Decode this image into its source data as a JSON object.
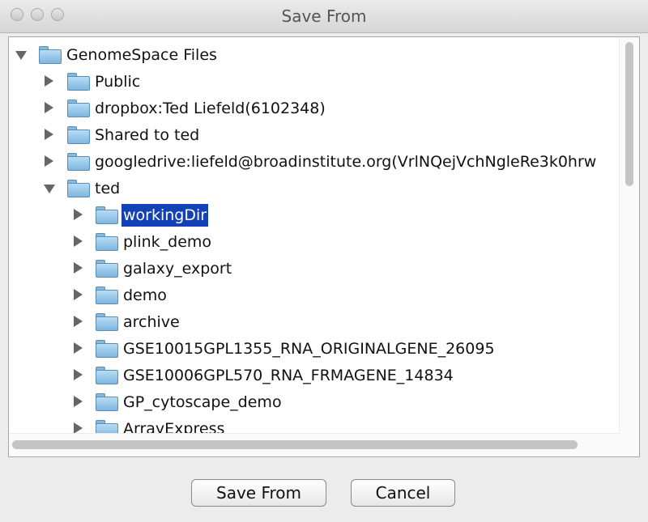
{
  "window": {
    "title": "Save From"
  },
  "tree": {
    "root": {
      "label": "GenomeSpace Files",
      "expanded": true
    },
    "top_items": [
      {
        "label": "Public",
        "expanded": false
      },
      {
        "label": "dropbox:Ted Liefeld(6102348)",
        "expanded": false
      },
      {
        "label": "Shared to ted",
        "expanded": false
      },
      {
        "label": "googledrive:liefeld@broadinstitute.org(VrlNQejVchNgleRe3k0hrw",
        "expanded": false
      },
      {
        "label": "ted",
        "expanded": true
      }
    ],
    "ted_children": [
      {
        "label": "workingDir",
        "selected": true
      },
      {
        "label": "plink_demo"
      },
      {
        "label": "galaxy_export"
      },
      {
        "label": "demo"
      },
      {
        "label": "archive"
      },
      {
        "label": "GSE10015GPL1355_RNA_ORIGINALGENE_26095"
      },
      {
        "label": "GSE10006GPL570_RNA_FRMAGENE_14834"
      },
      {
        "label": "GP_cytoscape_demo"
      },
      {
        "label": "ArrayExpress"
      }
    ],
    "icons": {
      "expanded": "triangle-down-icon",
      "collapsed": "triangle-right-icon",
      "node": "folder-icon"
    },
    "selection_color": "#1440b8"
  },
  "buttons": {
    "save": "Save From",
    "cancel": "Cancel"
  }
}
